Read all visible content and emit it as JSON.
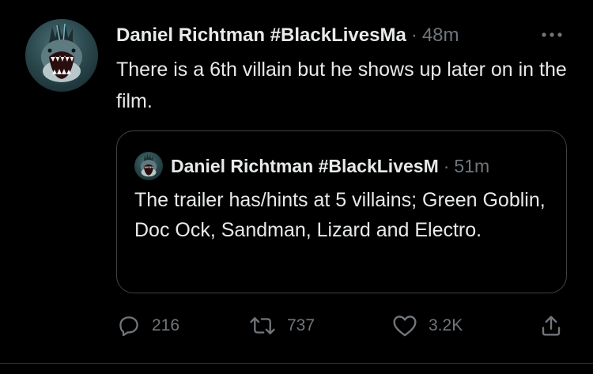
{
  "tweet": {
    "author_name": "Daniel Richtman #BlackLivesMa",
    "separator": "·",
    "time": "48m",
    "more_icon": "more-horizontal-icon",
    "text": "There is a 6th villain but he shows up later on in the film."
  },
  "quoted_tweet": {
    "author_name": "Daniel Richtman #BlackLivesM",
    "separator": "·",
    "time": "51m",
    "text": "The trailer has/hints at 5 villains; Green Goblin, Doc Ock, Sandman, Lizard and Electro."
  },
  "actions": {
    "reply": {
      "icon": "reply-icon",
      "count": "216"
    },
    "retweet": {
      "icon": "retweet-icon",
      "count": "737"
    },
    "like": {
      "icon": "heart-icon",
      "count": "3.2K"
    },
    "share": {
      "icon": "share-icon"
    }
  },
  "colors": {
    "background": "#000000",
    "primary_text": "#e7e9ea",
    "secondary_text": "#71767b",
    "border": "#3e4144"
  }
}
